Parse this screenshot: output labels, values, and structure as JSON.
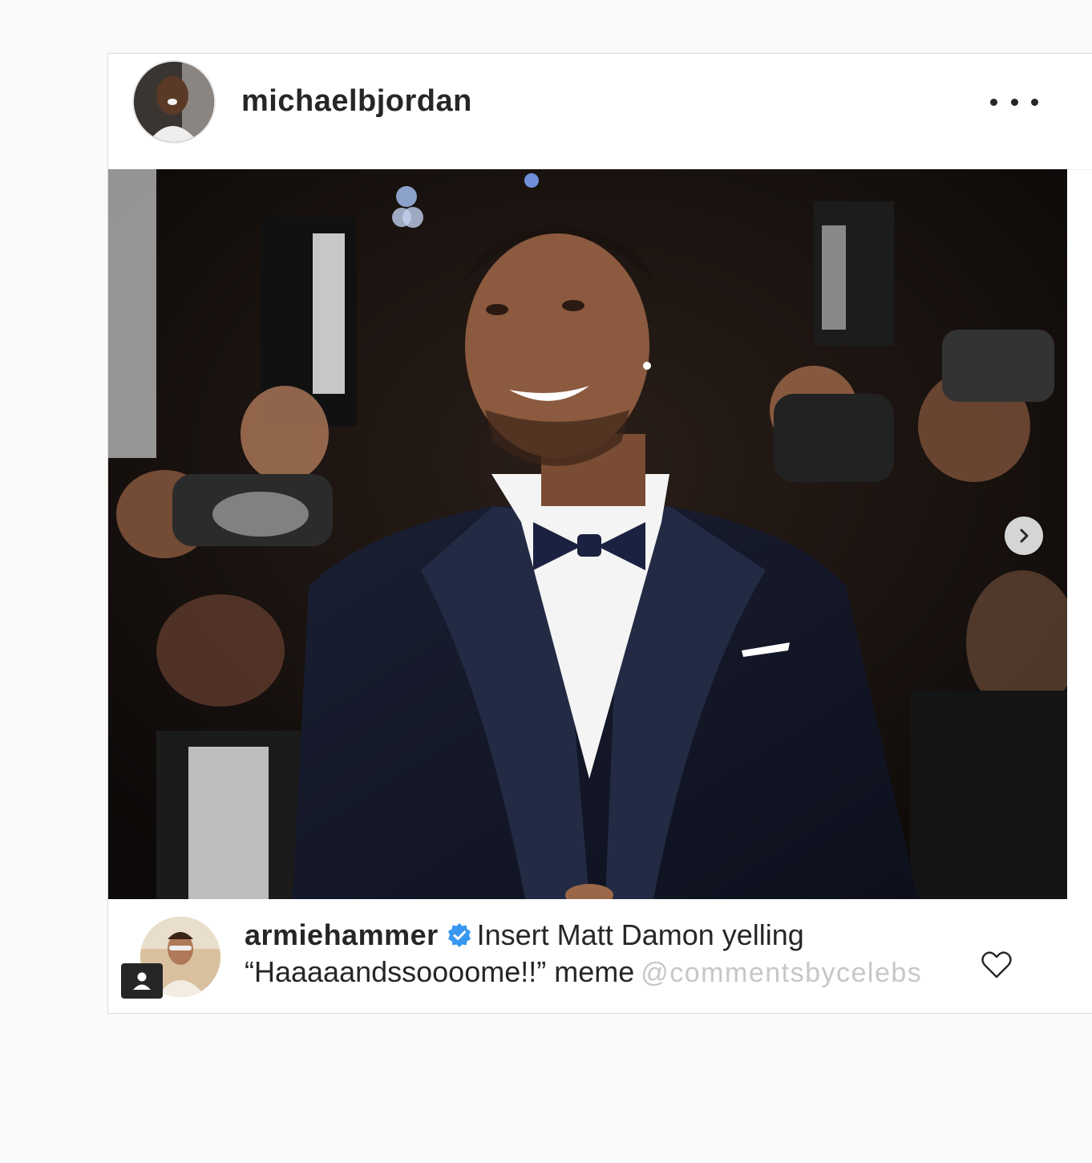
{
  "post": {
    "username": "michaelbjordan",
    "more_icon": "ellipsis-icon"
  },
  "comment": {
    "username": "armiehammer",
    "text_line1": "Insert Matt Damon yelling",
    "text_line2": "“Haaaaandssoooome!!” meme",
    "watermark": "@commentsbycelebs"
  },
  "colors": {
    "text": "#262626",
    "verified": "#3897f0",
    "border": "#dbdbdb",
    "watermark": "#c7c7c7"
  }
}
